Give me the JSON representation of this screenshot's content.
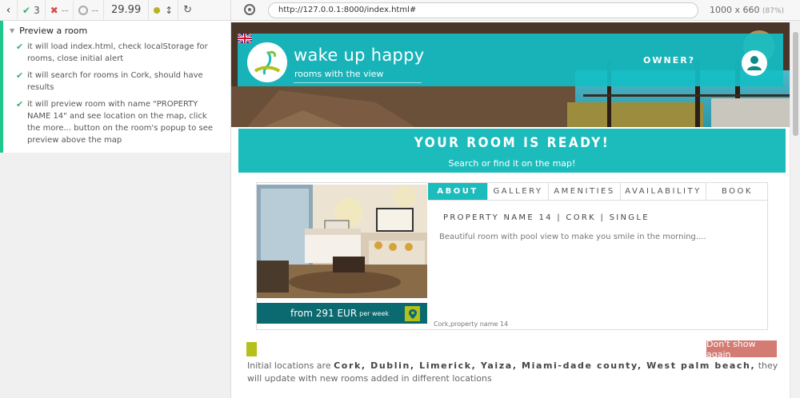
{
  "runner": {
    "back_icon": "chevron-left-icon",
    "passed_count": "3",
    "failed_count": "--",
    "pending_count": "--",
    "duration": "29.99",
    "status_color": "#b5b321"
  },
  "suite": {
    "title": "Preview a room",
    "tests": [
      "it will load index.html, check localStorage for rooms, close initial alert",
      "it will search for rooms in Cork, should have results",
      "it will preview room with name \"PROPERTY NAME 14\" and see location on the map, click the more... button on the room's popup to see preview above the map"
    ]
  },
  "browser": {
    "url": "http://127.0.0.1:8000/index.html#",
    "viewport": "1000 x 660",
    "zoom": "(87%)"
  },
  "site": {
    "brand_title": "wake up happy",
    "brand_subtitle": "rooms with the view",
    "owner_link": "OWNER?",
    "accent": "#1cbcbc"
  },
  "banner": {
    "title": "YOUR ROOM IS READY!",
    "subtitle": "Search or find it on the map!"
  },
  "property": {
    "price": "from 291 EUR",
    "price_period": "per week",
    "tabs": [
      "ABOUT",
      "GALLERY",
      "AMENITIES",
      "AVAILABILITY",
      "BOOK"
    ],
    "active_tab": "ABOUT",
    "title": "PROPERTY NAME 14 | CORK | SINGLE",
    "description": "Beautiful room with pool view to make you smile in the morning....",
    "footer": "Cork,property name 14"
  },
  "alert": {
    "dont_show_label": "Don't show again",
    "intro": "Initial locations are",
    "cities": "Cork, Dublin, Limerick, Yaiza, Miami-dade county, West palm beach,",
    "outro": " they will update with new rooms added in different locations"
  }
}
